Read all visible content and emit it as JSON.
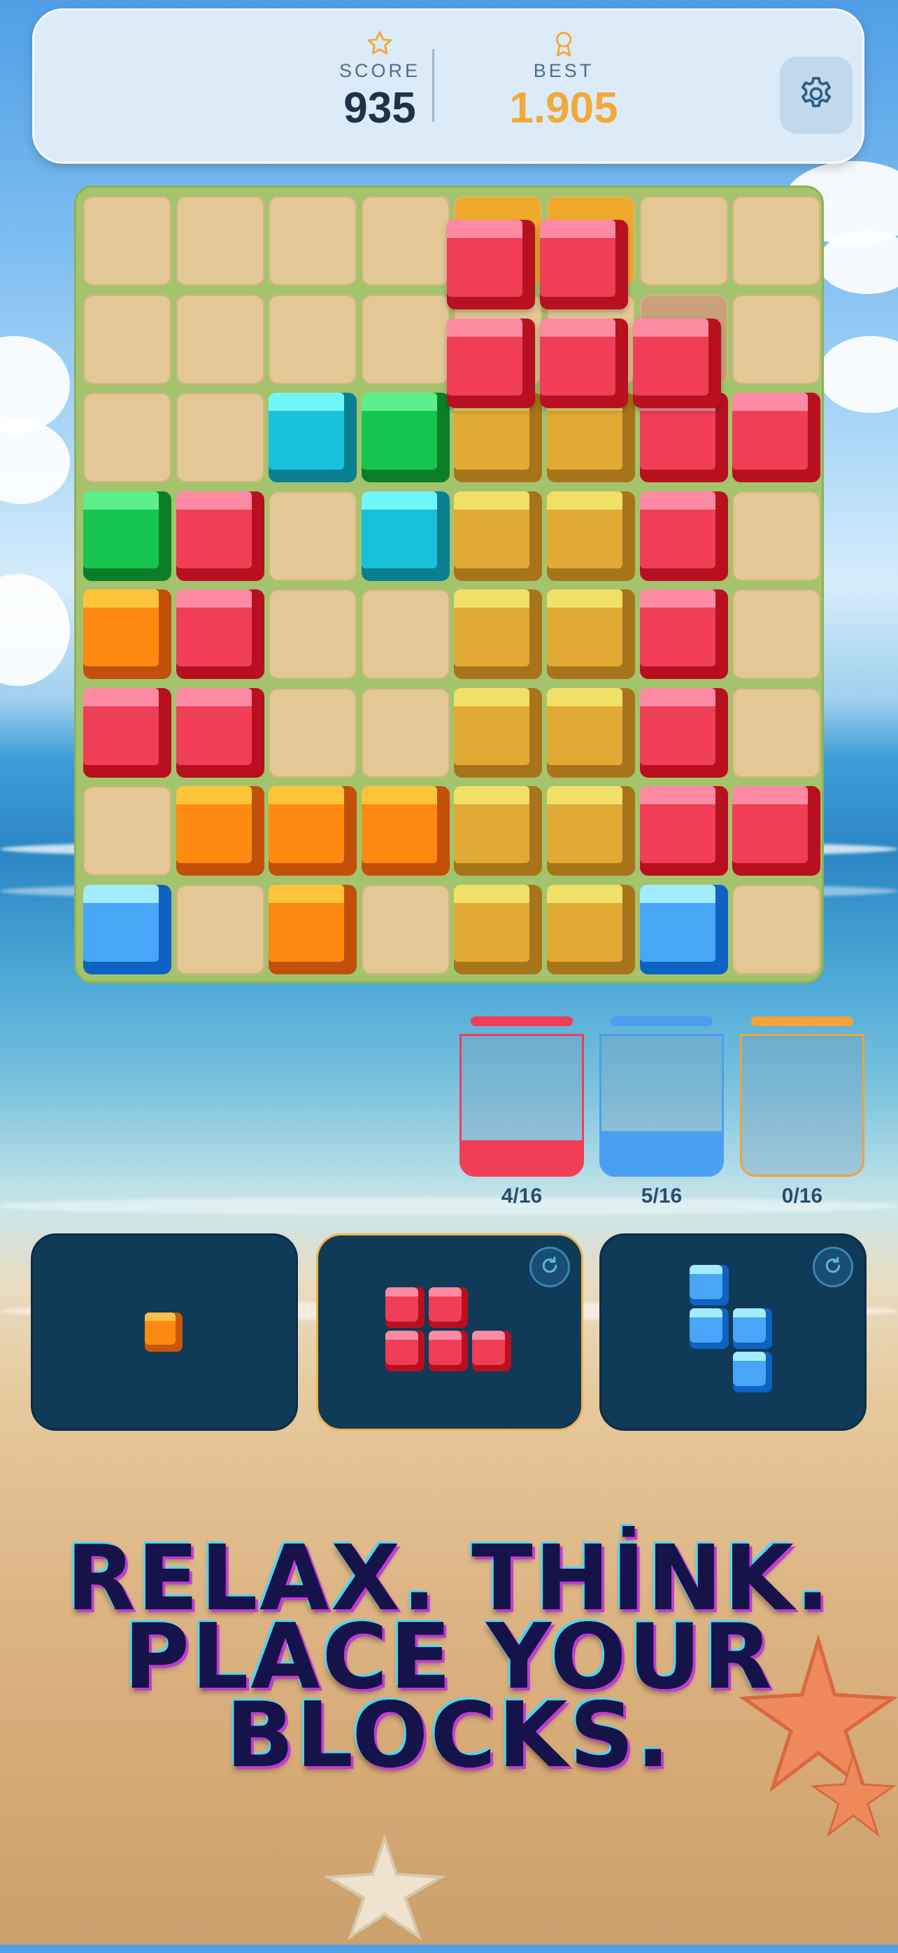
{
  "header": {
    "score_label": "SCORE",
    "score_value": "935",
    "best_label": "BEST",
    "best_value": "1.905",
    "settings_icon": "gear-icon"
  },
  "colors": {
    "red": "#f03e57",
    "yellow": "#e0aa35",
    "green": "#16c54e",
    "cyan": "#19c0d9",
    "orange": "#ff8a12",
    "blue": "#47a6f5",
    "empty": "#e3c896",
    "board_bg": "#a4c36d"
  },
  "board": {
    "rows": [
      [
        "E",
        "E",
        "E",
        "E",
        "E",
        "E",
        "E",
        "E"
      ],
      [
        "E",
        "E",
        "E",
        "E",
        "E",
        "E",
        "E",
        "E"
      ],
      [
        "E",
        "E",
        "C",
        "G",
        "Y",
        "Y",
        "R",
        "R"
      ],
      [
        "G",
        "R",
        "E",
        "C",
        "Y",
        "Y",
        "R",
        "E"
      ],
      [
        "O",
        "R",
        "E",
        "E",
        "Y",
        "Y",
        "R",
        "E"
      ],
      [
        "R",
        "R",
        "E",
        "E",
        "Y",
        "Y",
        "R",
        "E"
      ],
      [
        "E",
        "O",
        "O",
        "O",
        "Y",
        "Y",
        "R",
        "R"
      ],
      [
        "B",
        "E",
        "O",
        "E",
        "Y",
        "Y",
        "B",
        "E"
      ]
    ],
    "preview": {
      "highlight_cells": [
        [
          0,
          4
        ],
        [
          0,
          5
        ],
        [
          1,
          6
        ]
      ],
      "piece_cells": [
        [
          0,
          4
        ],
        [
          0,
          5
        ],
        [
          1,
          4
        ],
        [
          1,
          5
        ],
        [
          1,
          6
        ]
      ]
    }
  },
  "goals": [
    {
      "color": "#f03e57",
      "label": "4/16",
      "progress": 0.25
    },
    {
      "color": "#4a9ff0",
      "label": "5/16",
      "progress": 0.3125
    },
    {
      "color": "#f2a33a",
      "label": "0/16",
      "progress": 0
    }
  ],
  "trays": [
    {
      "piece": "single-orange",
      "selected": false,
      "rotate_icon": false
    },
    {
      "piece": "red-five",
      "selected": true,
      "rotate_icon": true
    },
    {
      "piece": "blue-four",
      "selected": false,
      "rotate_icon": true
    }
  ],
  "tagline": {
    "line1": "RELAX. THİNK.",
    "line2": "PLACE YOUR",
    "line3": "BLOCKS."
  }
}
